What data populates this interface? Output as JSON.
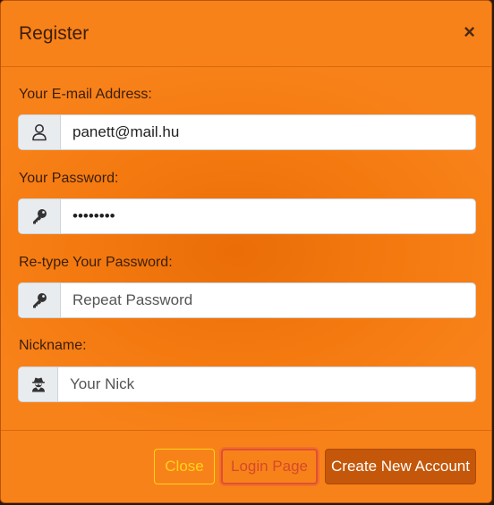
{
  "modal": {
    "title": "Register",
    "close_symbol": "×"
  },
  "fields": {
    "email": {
      "label": "Your E-mail Address:",
      "value": "panett@mail.hu",
      "icon": "user-icon"
    },
    "password": {
      "label": "Your Password:",
      "value": "••••••••",
      "icon": "key-icon"
    },
    "repeat_password": {
      "label": "Re-type Your Password:",
      "placeholder": "Repeat Password",
      "icon": "key-icon"
    },
    "nickname": {
      "label": "Nickname:",
      "placeholder": "Your Nick",
      "icon": "user-secret-icon"
    }
  },
  "footer": {
    "close_label": "Close",
    "login_label": "Login Page",
    "create_label": "Create New Account"
  },
  "colors": {
    "modal_bg": "#f47a10",
    "close_button": "#ffd21a",
    "login_button": "#d54a2a",
    "create_button": "#c4570a"
  }
}
